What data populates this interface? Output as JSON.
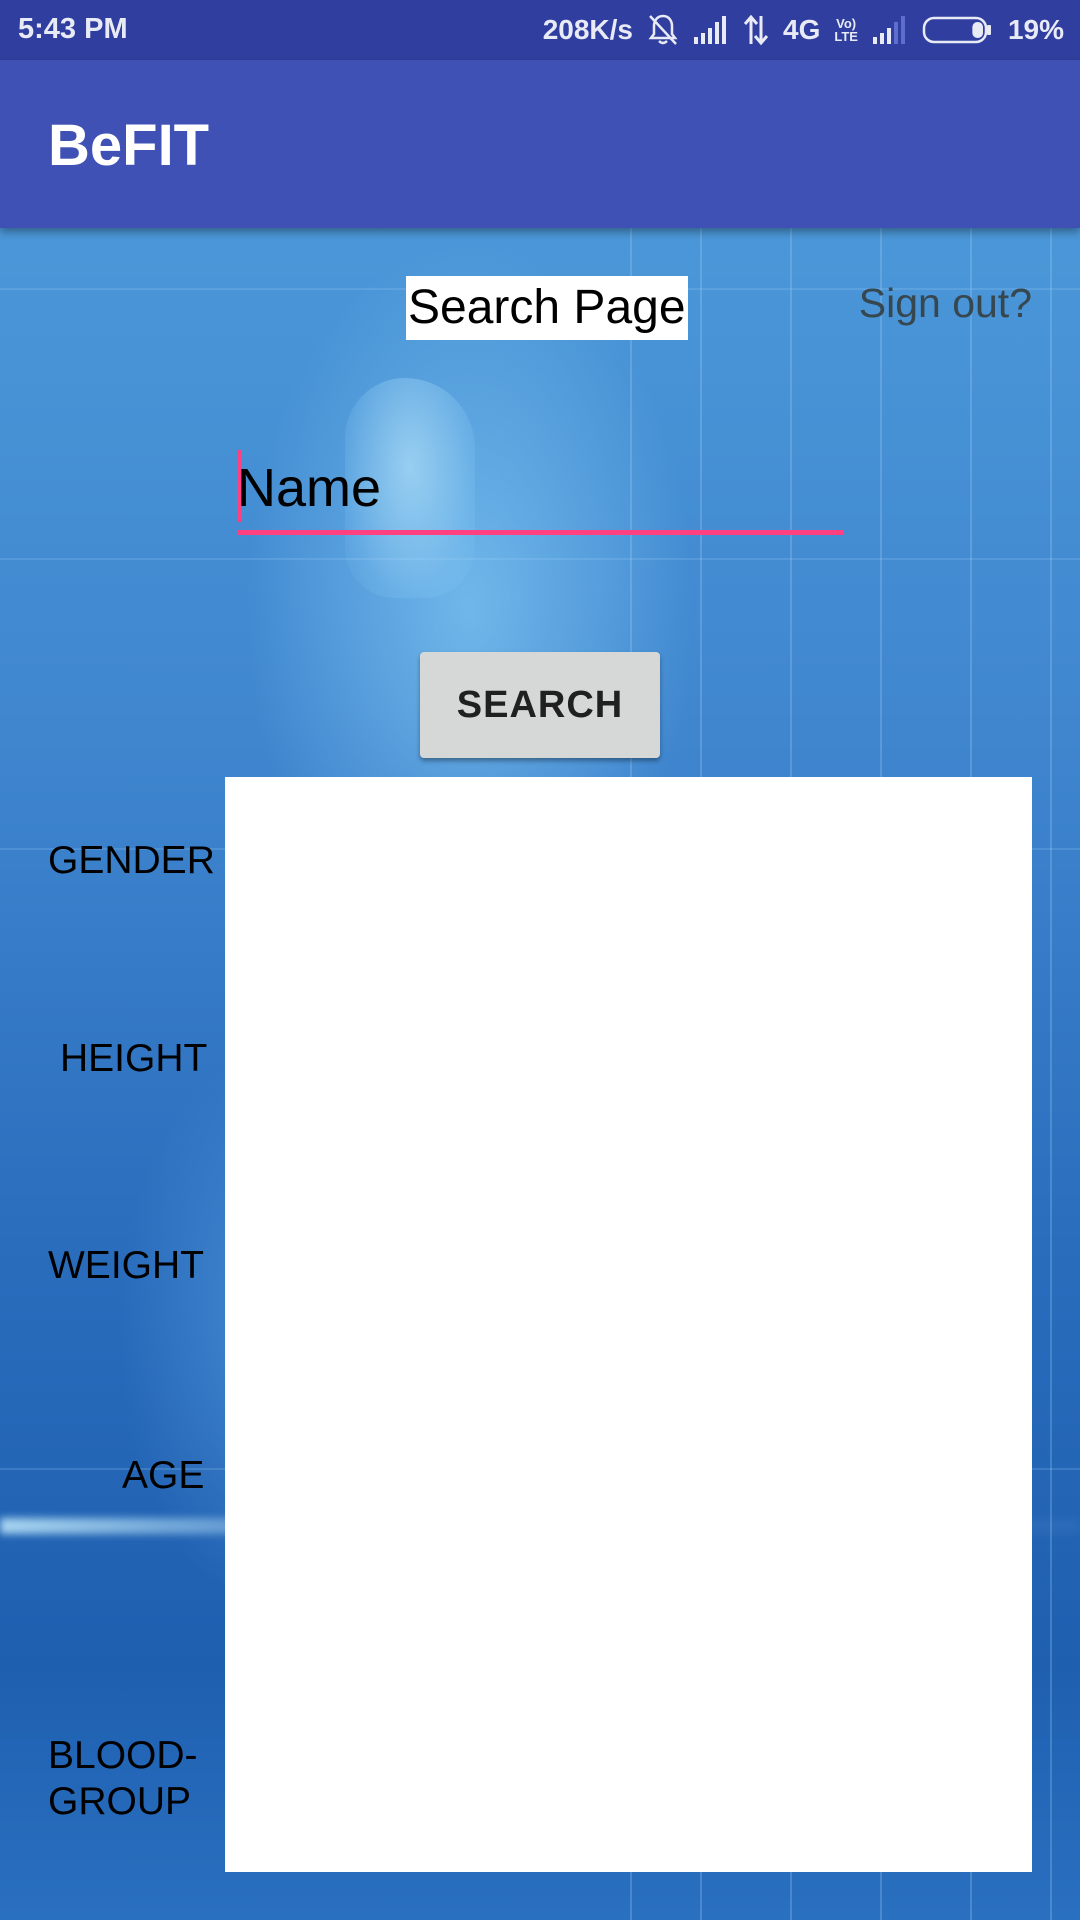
{
  "status_bar": {
    "time": "5:43 PM",
    "net_speed": "208K/s",
    "network_type": "4G",
    "volte_top": "Vo)",
    "volte_bottom": "LTE",
    "battery": "19%",
    "battery_level": 0.19,
    "icons": [
      "bell-off-icon",
      "signal-icon",
      "data-arrows-icon",
      "signal-icon",
      "battery-icon"
    ]
  },
  "app_bar": {
    "title": "BeFIT"
  },
  "header": {
    "page_label": "Search Page",
    "signout": "Sign out?"
  },
  "search": {
    "placeholder": "Name",
    "value": "",
    "button_label": "SEARCH"
  },
  "fields": {
    "gender": "GENDER",
    "height": "HEIGHT",
    "weight": "WEIGHT",
    "age": "AGE",
    "blood_group_line1": "BLOOD-",
    "blood_group_line2": "GROUP"
  },
  "colors": {
    "status_bar": "#303f9f",
    "app_bar": "#3f51b5",
    "accent": "#ff4081",
    "button": "#d6d7d7"
  }
}
